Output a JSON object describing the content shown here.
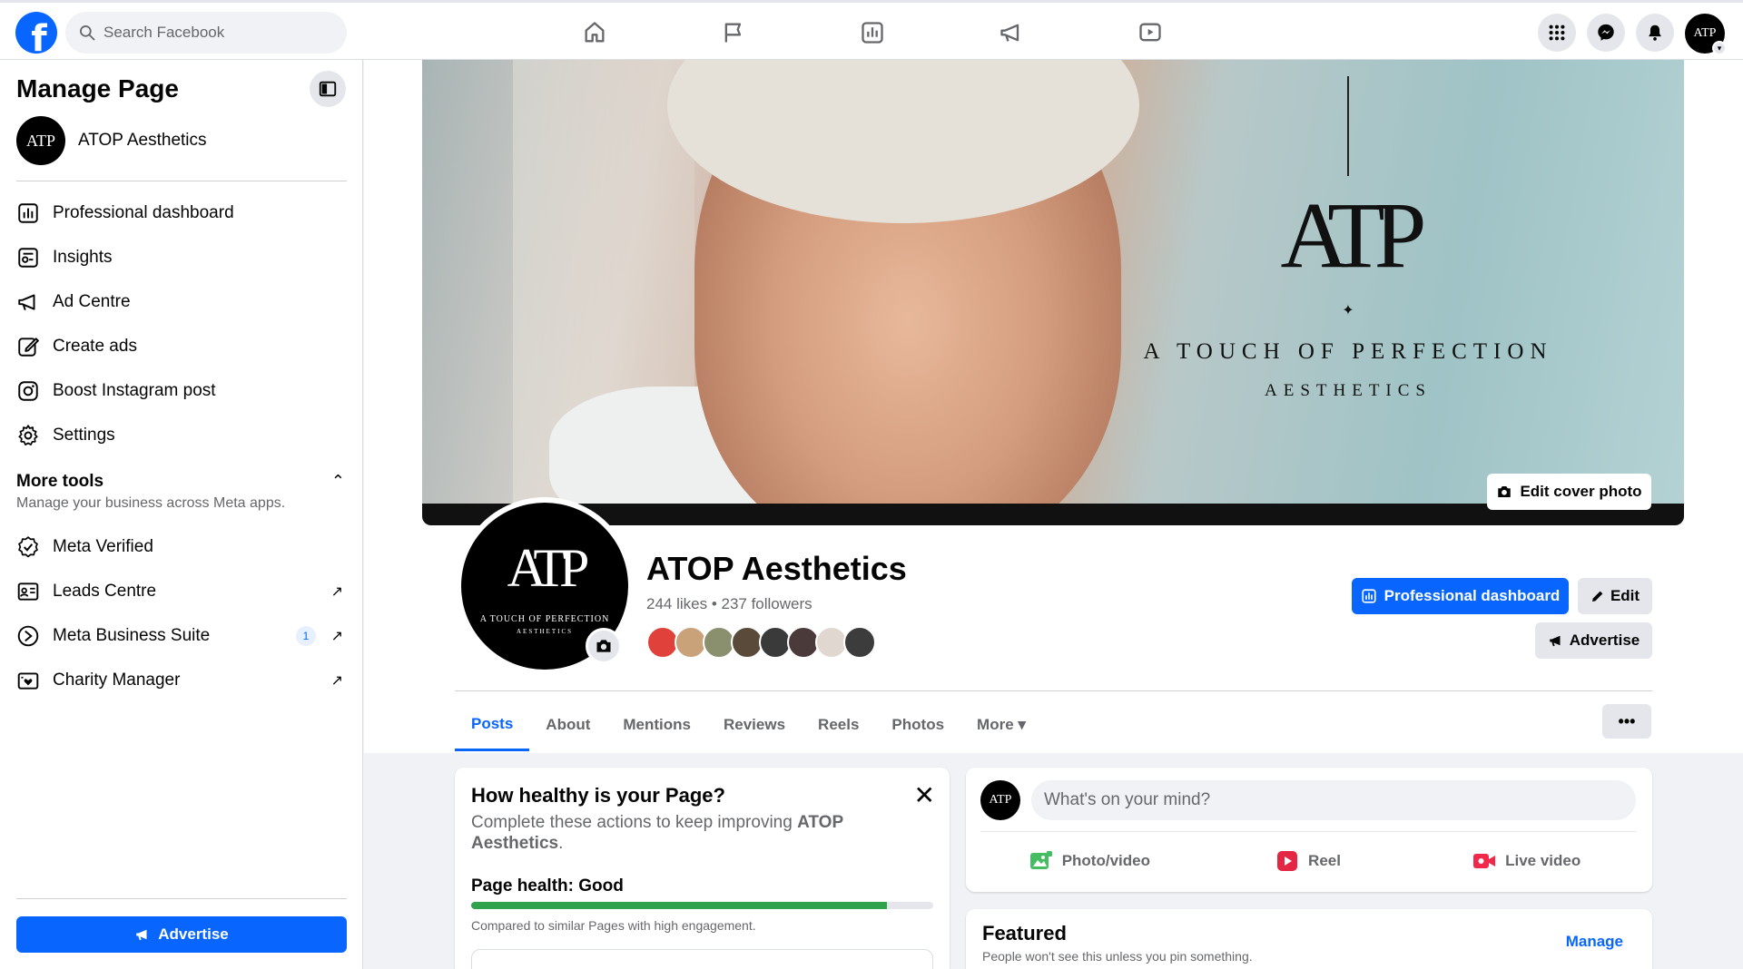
{
  "topbar": {
    "logo": "f",
    "search_placeholder": "Search Facebook",
    "nav": [
      "home-icon",
      "flag-icon",
      "chart-icon",
      "megaphone-icon",
      "video-icon"
    ],
    "right": [
      "menu-grid-icon",
      "messenger-icon",
      "bell-icon",
      "profile-avatar"
    ]
  },
  "sidebar": {
    "title": "Manage Page",
    "page_name": "ATOP Aesthetics",
    "page_logo": "ATP",
    "items": [
      {
        "label": "Professional dashboard",
        "icon": "dashboard-icon"
      },
      {
        "label": "Insights",
        "icon": "insights-icon"
      },
      {
        "label": "Ad Centre",
        "icon": "megaphone-icon"
      },
      {
        "label": "Create ads",
        "icon": "edit-icon"
      },
      {
        "label": "Boost Instagram post",
        "icon": "instagram-icon"
      },
      {
        "label": "Settings",
        "icon": "gear-icon"
      }
    ],
    "more_tools": {
      "title": "More tools",
      "subtitle": "Manage your business across Meta apps."
    },
    "tools": [
      {
        "label": "Meta Verified",
        "icon": "verified-icon"
      },
      {
        "label": "Leads Centre",
        "icon": "leads-icon",
        "external": "↗"
      },
      {
        "label": "Meta Business Suite",
        "icon": "business-suite-icon",
        "badge": "1",
        "external": "↗"
      },
      {
        "label": "Charity Manager",
        "icon": "charity-icon",
        "external": "↗"
      }
    ],
    "advertise_label": "Advertise"
  },
  "cover": {
    "logo_mark": "ATP",
    "tagline_1": "A TOUCH OF PERFECTION",
    "tagline_2": "AESTHETICS",
    "diamond": "✦",
    "edit_label": "Edit cover photo"
  },
  "profile": {
    "name": "ATOP Aesthetics",
    "stats": "244 likes • 237 followers",
    "logo_mark": "ATP",
    "logo_sub": "A TOUCH OF PERFECTION",
    "logo_sub2": "AESTHETICS",
    "follower_colors": [
      "#e0413a",
      "#c9a27a",
      "#8a8f6e",
      "#5a4a3a",
      "#3a3a3a",
      "#4a3a3a",
      "#e0d8d0",
      "#3c3c3c"
    ]
  },
  "actions": {
    "dashboard_label": "Professional dashboard",
    "edit_label": "Edit",
    "advertise_label": "Advertise"
  },
  "tabs": [
    {
      "label": "Posts",
      "active": true
    },
    {
      "label": "About"
    },
    {
      "label": "Mentions"
    },
    {
      "label": "Reviews"
    },
    {
      "label": "Reels"
    },
    {
      "label": "Photos"
    },
    {
      "label": "More ▾"
    }
  ],
  "tabs_overflow": "•••",
  "health": {
    "title": "How healthy is your Page?",
    "desc_prefix": "Complete these actions to keep improving ",
    "desc_bold": "ATOP Aesthetics",
    "desc_suffix": ".",
    "label": "Page health: Good",
    "progress": 0.9,
    "progress_color": "#31a24c",
    "note": "Compared to similar Pages with high engagement."
  },
  "composer": {
    "placeholder": "What's on your mind?",
    "actions": [
      {
        "label": "Photo/video",
        "color": "#45bd62"
      },
      {
        "label": "Reel",
        "color": "#e42645"
      },
      {
        "label": "Live video",
        "color": "#f02849"
      }
    ]
  },
  "featured": {
    "title": "Featured",
    "subtitle": "People won't see this unless you pin something.",
    "manage_label": "Manage"
  },
  "colors": {
    "brand": "#0866ff",
    "background": "#f0f2f5"
  }
}
